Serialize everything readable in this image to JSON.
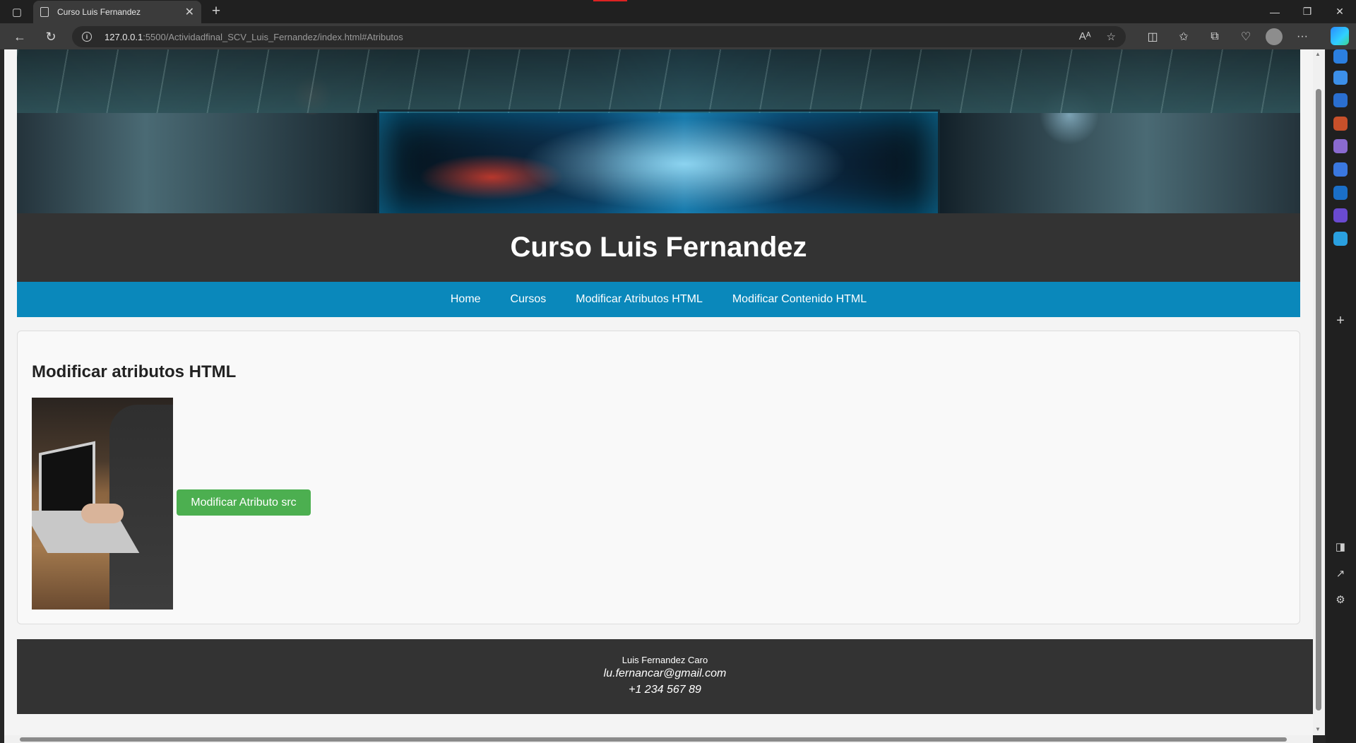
{
  "browser": {
    "tab_title": "Curso Luis Fernandez",
    "url_host": "127.0.0.1",
    "url_rest": ":5500/Actividadfinal_SCV_Luis_Fernandez/index.html#Atributos",
    "tab_close": "✕",
    "new_tab": "+",
    "window_buttons": {
      "minimize": "—",
      "restore": "❐",
      "close": "✕"
    }
  },
  "site": {
    "title": "Curso Luis Fernandez",
    "nav": [
      "Home",
      "Cursos",
      "Modificar Atributos HTML",
      "Modificar Contenido HTML"
    ]
  },
  "section": {
    "heading": "Modificar atributos HTML",
    "button_label": "Modificar Atributo src"
  },
  "footer": {
    "name": "Luis Fernandez Caro",
    "email": "lu.fernancar@gmail.com",
    "phone": "+1 234 567 89"
  },
  "colors": {
    "nav_bg": "#0a88bb",
    "header_bg": "#333333",
    "button_bg": "#4caf50"
  }
}
